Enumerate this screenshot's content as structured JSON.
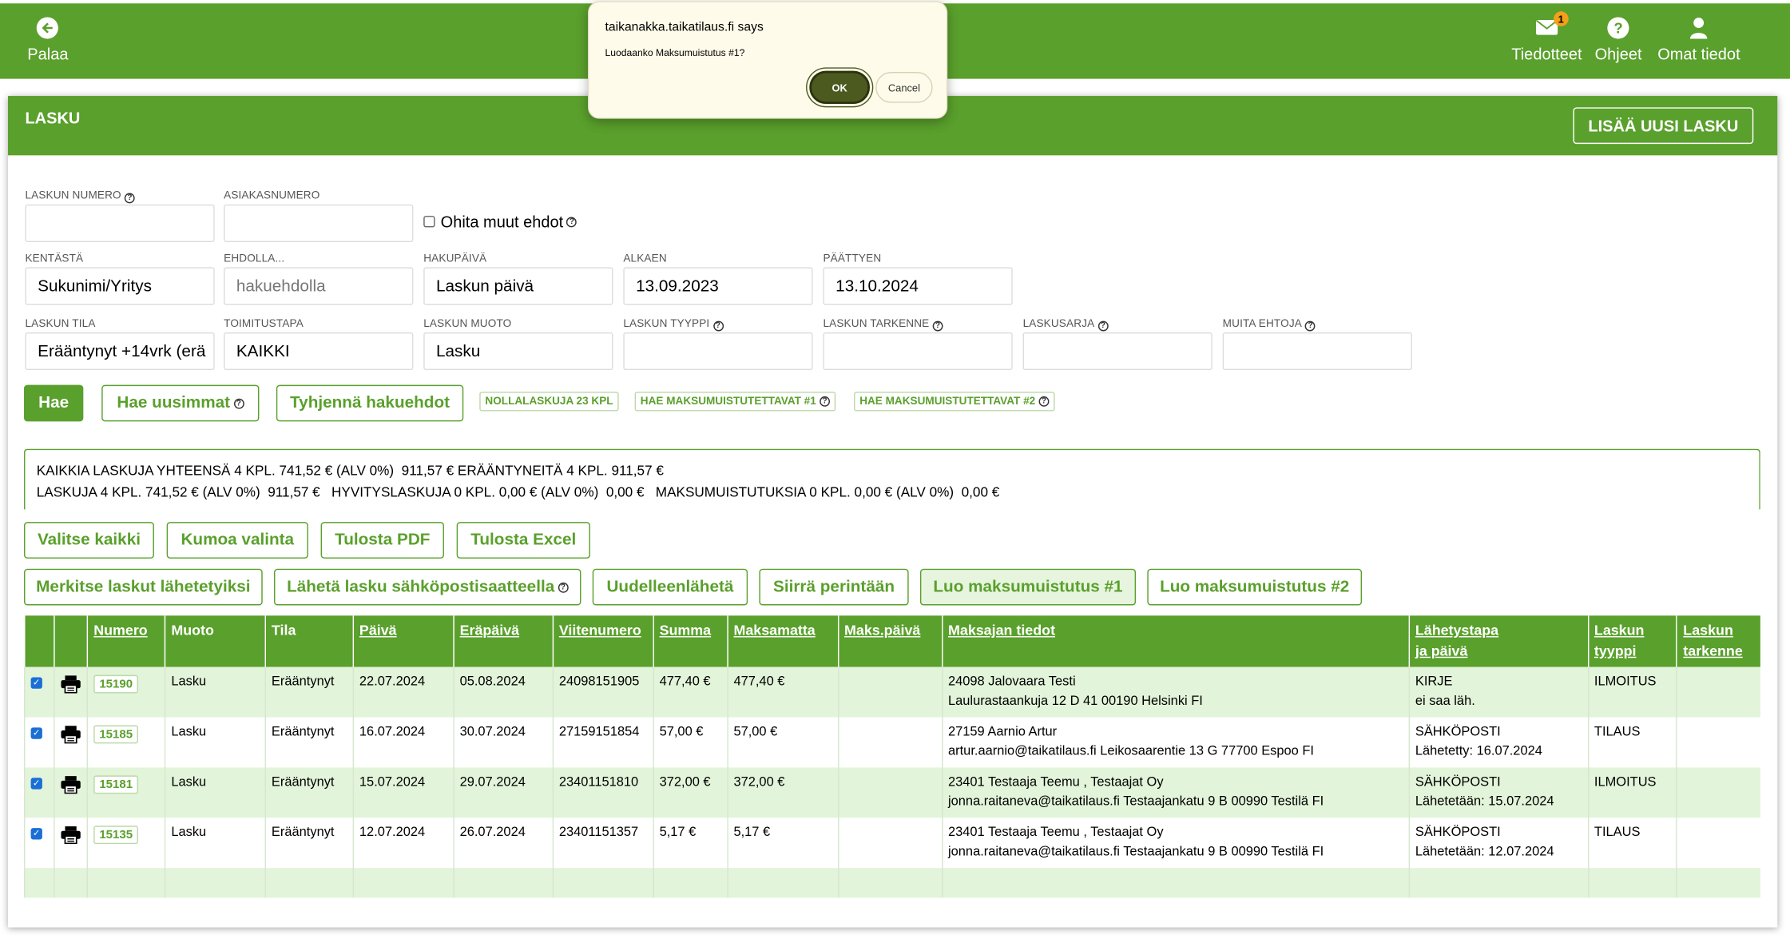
{
  "topbar": {
    "back_label": "Palaa",
    "notices_label": "Tiedotteet",
    "notices_badge": "1",
    "help_label": "Ohjeet",
    "help_glyph": "?",
    "profile_label": "Omat tiedot",
    "color": "#5aa02c"
  },
  "dialog": {
    "title": "taikanakka.taikatilaus.fi says",
    "message": "Luodaanko Maksumuistutus #1?",
    "ok": "OK",
    "cancel": "Cancel"
  },
  "card": {
    "title": "LASKU",
    "new_button": "LISÄÄ UUSI LASKU"
  },
  "search": {
    "invoice_number_label": "LASKUN NUMERO",
    "invoice_number_value": "",
    "customer_number_label": "ASIAKASNUMERO",
    "customer_number_value": "",
    "ignore_label": "Ohita muut ehdot",
    "field_label": "KENTÄSTÄ",
    "field_value": "Sukunimi/Yritys",
    "condition_label": "EHDOLLA...",
    "condition_placeholder": "hakuehdolla",
    "date_type_label": "HAKUPÄIVÄ",
    "date_type_value": "Laskun päivä",
    "start_label": "ALKAEN",
    "start_value": "13.09.2023",
    "end_label": "PÄÄTTYEN",
    "end_value": "13.10.2024",
    "state_label": "LASKUN TILA",
    "state_value": "Erääntynyt +14vrk (erä",
    "delivery_label": "TOIMITUSTAPA",
    "delivery_value": "KAIKKI",
    "form_label": "LASKUN MUOTO",
    "form_value": "Lasku",
    "type_label": "LASKUN TYYPPI",
    "type_value": "",
    "refine_label": "LASKUN TARKENNE",
    "refine_value": "",
    "series_label": "LASKUSARJA",
    "series_value": "",
    "other_label": "MUITA EHTOJA",
    "other_value": ""
  },
  "actions": {
    "search": "Hae",
    "latest": "Hae uusimmat",
    "clear": "Tyhjennä hakuehdot",
    "chip_zero": "NOLLALASKUJA 23 KPL",
    "chip_reminder1": "HAE MAKSUMUISTUTETTAVAT #1",
    "chip_reminder2": "HAE MAKSUMUISTUTETTAVAT #2"
  },
  "summary": {
    "line1": "KAIKKIA LASKUJA YHTEENSÄ 4 KPL. 741,52 € (ALV 0%)  911,57 € ERÄÄNTYNEITÄ 4 KPL. 911,57 €",
    "line2": "LASKUJA 4 KPL. 741,52 € (ALV 0%)  911,57 €   HYVITYSLASKUJA 0 KPL. 0,00 € (ALV 0%)  0,00 €   MAKSUMUISTUTUKSIA 0 KPL. 0,00 € (ALV 0%)  0,00 €"
  },
  "bulk": {
    "select_all": "Valitse kaikki",
    "deselect": "Kumoa valinta",
    "print_pdf": "Tulosta PDF",
    "print_excel": "Tulosta Excel",
    "mark_sent": "Merkitse laskut lähetetyiksi",
    "send_email": "Lähetä lasku sähköpostisaatteella",
    "resend": "Uudelleenlähetä",
    "collection": "Siirrä perintään",
    "reminder1": "Luo maksumuistutus #1",
    "reminder2": "Luo maksumuistutus #2"
  },
  "table": {
    "headers": {
      "number": "Numero",
      "form": "Muoto",
      "state": "Tila",
      "date": "Päivä",
      "due": "Eräpäivä",
      "ref": "Viitenumero",
      "sum": "Summa",
      "unpaid": "Maksamatta",
      "paydate": "Maks.päivä",
      "payer": "Maksajan tiedot",
      "send_1": "Lähetystapa",
      "send_2": "ja päivä",
      "type_1": "Laskun",
      "type_2": "tyyppi",
      "refine_1": "Laskun",
      "refine_2": "tarkenne"
    },
    "rows": [
      {
        "number": "15190",
        "form": "Lasku",
        "state": "Erääntynyt",
        "date": "22.07.2024",
        "due": "05.08.2024",
        "ref": "24098151905",
        "sum": "477,40 €",
        "unpaid": "477,40 €",
        "paydate": "",
        "payer_1": "24098 Jalovaara Testi",
        "payer_2": "Laulurastaankuja 12 D 41 00190 Helsinki FI",
        "send_1": "KIRJE",
        "send_2": "ei saa läh.",
        "type": "ILMOITUS",
        "refine": ""
      },
      {
        "number": "15185",
        "form": "Lasku",
        "state": "Erääntynyt",
        "date": "16.07.2024",
        "due": "30.07.2024",
        "ref": "27159151854",
        "sum": "57,00 €",
        "unpaid": "57,00 €",
        "paydate": "",
        "payer_1": "27159 Aarnio Artur",
        "payer_2": "artur.aarnio@taikatilaus.fi Leikosaarentie 13 G 77700 Espoo FI",
        "send_1": "SÄHKÖPOSTI",
        "send_2": "Lähetetty: 16.07.2024",
        "type": "TILAUS",
        "refine": ""
      },
      {
        "number": "15181",
        "form": "Lasku",
        "state": "Erääntynyt",
        "date": "15.07.2024",
        "due": "29.07.2024",
        "ref": "23401151810",
        "sum": "372,00 €",
        "unpaid": "372,00 €",
        "paydate": "",
        "payer_1": "23401 Testaaja Teemu , Testaajat Oy",
        "payer_2": "jonna.raitaneva@taikatilaus.fi Testaajankatu 9 B 00990 Testilä FI",
        "send_1": "SÄHKÖPOSTI",
        "send_2": "Lähetetään: 15.07.2024",
        "type": "ILMOITUS",
        "refine": ""
      },
      {
        "number": "15135",
        "form": "Lasku",
        "state": "Erääntynyt",
        "date": "12.07.2024",
        "due": "26.07.2024",
        "ref": "23401151357",
        "sum": "5,17 €",
        "unpaid": "5,17 €",
        "paydate": "",
        "payer_1": "23401 Testaaja Teemu , Testaajat Oy",
        "payer_2": "jonna.raitaneva@taikatilaus.fi Testaajankatu 9 B 00990 Testilä FI",
        "send_1": "SÄHKÖPOSTI",
        "send_2": "Lähetetään: 12.07.2024",
        "type": "TILAUS",
        "refine": ""
      }
    ]
  }
}
